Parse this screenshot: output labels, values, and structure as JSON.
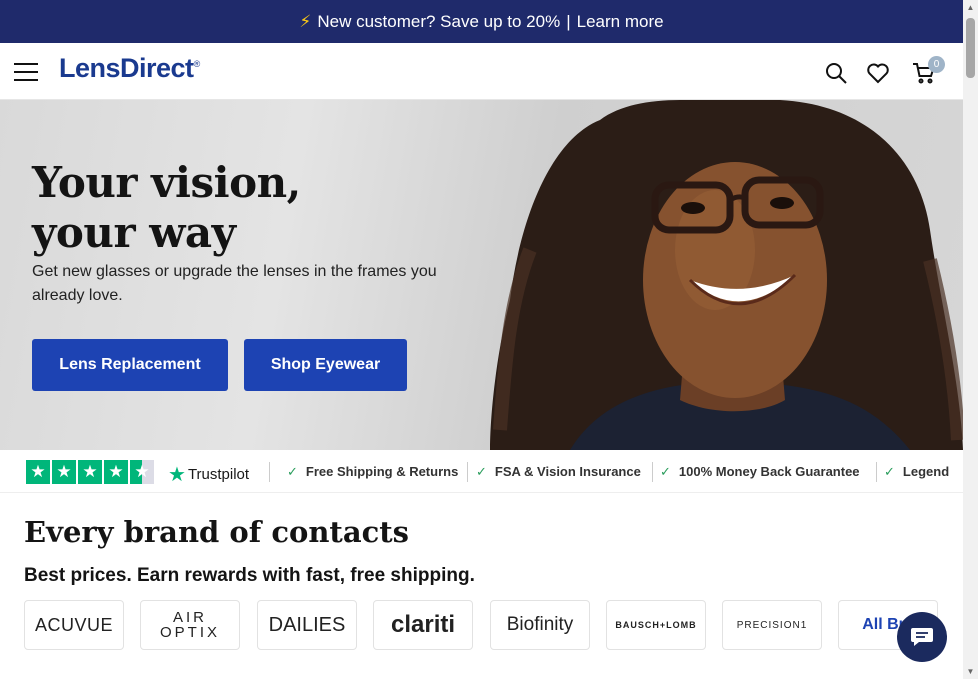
{
  "promo": {
    "icon": "lightning-icon",
    "text": "New customer? Save up to 20%",
    "separator": "|",
    "link": "Learn more"
  },
  "header": {
    "logo": "LensDirect",
    "logo_mark": "®",
    "cart_count": "0"
  },
  "hero": {
    "title_line1": "Your vision,",
    "title_line2": "your way",
    "subtitle": "Get new glasses or upgrade the lenses in the frames you already love.",
    "btn_primary": "Lens Replacement",
    "btn_secondary": "Shop Eyewear"
  },
  "trust": {
    "rating_stars": 4.5,
    "provider": "Trustpilot",
    "features": [
      "Free Shipping & Returns",
      "FSA & Vision Insurance",
      "100% Money Back Guarantee",
      "Legend"
    ]
  },
  "brands": {
    "title": "Every brand of contacts",
    "subtitle": "Best prices. Earn rewards with fast, free shipping.",
    "items": [
      "ACUVUE",
      "AIR OPTIX",
      "DAILIES",
      "clariti",
      "Biofinity",
      "BAUSCH+LOMB",
      "PRECISION1",
      "All Bra"
    ]
  },
  "colors": {
    "brand_blue": "#1d43b3",
    "promo_bar": "#1f2a6b",
    "trustpilot_green": "#00b67a",
    "chat_navy": "#1b2a5e"
  }
}
